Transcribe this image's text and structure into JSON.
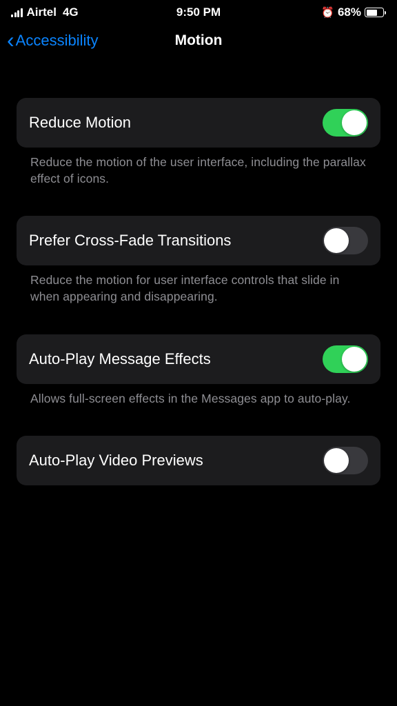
{
  "status": {
    "carrier": "Airtel",
    "network": "4G",
    "time": "9:50 PM",
    "battery_pct": "68%",
    "battery_fill_pct": 68
  },
  "nav": {
    "back_label": "Accessibility",
    "title": "Motion"
  },
  "settings": [
    {
      "id": "reduce-motion",
      "label": "Reduce Motion",
      "on": true,
      "desc": "Reduce the motion of the user interface, including the parallax effect of icons."
    },
    {
      "id": "prefer-cross-fade",
      "label": "Prefer Cross-Fade Transitions",
      "on": false,
      "desc": "Reduce the motion for user interface controls that slide in when appearing and disappearing."
    },
    {
      "id": "auto-play-message-effects",
      "label": "Auto-Play Message Effects",
      "on": true,
      "desc": "Allows full-screen effects in the Messages app to auto-play."
    },
    {
      "id": "auto-play-video-previews",
      "label": "Auto-Play Video Previews",
      "on": false,
      "desc": ""
    }
  ]
}
